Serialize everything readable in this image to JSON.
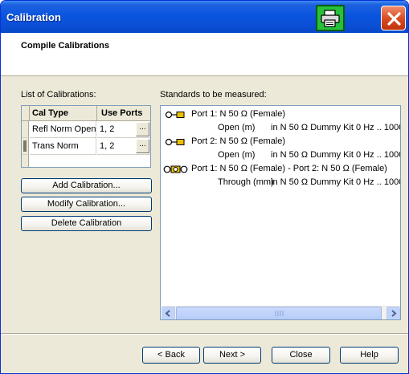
{
  "window": {
    "title": "Calibration",
    "print_icon": "print-icon",
    "close_icon": "close-icon"
  },
  "header": {
    "title": "Compile Calibrations"
  },
  "calibrations": {
    "label": "List of Calibrations:",
    "columns": [
      "Cal Type",
      "Use Ports"
    ],
    "rows": [
      {
        "type": "Refl Norm Open",
        "ports": "1, 2",
        "ellipsis": "...",
        "selected": false
      },
      {
        "type": "Trans Norm",
        "ports": "1, 2",
        "ellipsis": "...",
        "selected": true
      }
    ],
    "buttons": {
      "add": "Add Calibration...",
      "modify": "Modify Calibration...",
      "delete": "Delete Calibration"
    }
  },
  "standards": {
    "label": "Standards to be measured:",
    "items": [
      {
        "icon": "open-connector-icon",
        "port_line": "Port 1: N 50 Ω (Female)",
        "detail": "Open (m)",
        "kit": "in N 50 Ω Dummy Kit  0 Hz  .. 1000"
      },
      {
        "icon": "open-connector-icon",
        "port_line": "Port 2: N 50 Ω (Female)",
        "detail": "Open (m)",
        "kit": "in N 50 Ω Dummy Kit  0 Hz  .. 1000"
      },
      {
        "icon": "through-connector-icon",
        "port_line": "Port 1: N 50 Ω (Female) - Port 2: N 50 Ω (Female)",
        "detail": "Through (mm)",
        "kit": "in N 50 Ω Dummy Kit  0 Hz  .. 1000"
      }
    ]
  },
  "footer": {
    "back": "< Back",
    "next": "Next >",
    "close": "Close",
    "help": "Help"
  },
  "colors": {
    "titlebar": "#0a55df",
    "print_button": "#26c13a",
    "close_button": "#d84a1f",
    "scrollbar": "#c1d3fb"
  }
}
